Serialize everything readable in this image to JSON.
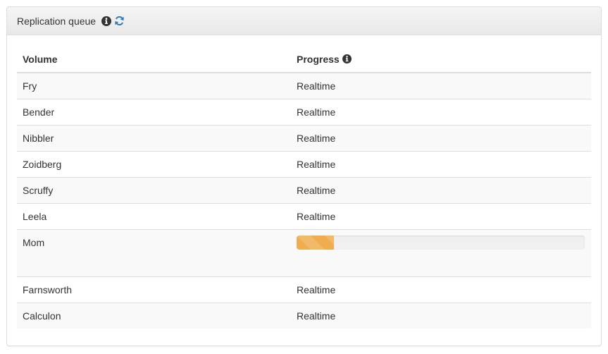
{
  "panel": {
    "title": "Replication queue",
    "info_icon": "info-circle-icon",
    "refresh_icon": "refresh-icon"
  },
  "table": {
    "headers": {
      "volume": "Volume",
      "progress": "Progress",
      "progress_info_icon": "info-circle-icon"
    },
    "rows": [
      {
        "volume": "Fry",
        "progress": "Realtime"
      },
      {
        "volume": "Bender",
        "progress": "Realtime"
      },
      {
        "volume": "Nibbler",
        "progress": "Realtime"
      },
      {
        "volume": "Zoidberg",
        "progress": "Realtime"
      },
      {
        "volume": "Scruffy",
        "progress": "Realtime"
      },
      {
        "volume": "Leela",
        "progress": "Realtime"
      },
      {
        "volume": "Mom",
        "progress_fraction": 0.13
      },
      {
        "volume": "Farnsworth",
        "progress": "Realtime"
      },
      {
        "volume": "Calculon",
        "progress": "Realtime"
      }
    ]
  },
  "colors": {
    "progress_bar": "#f0ad4e",
    "refresh_icon": "#337ab7"
  }
}
